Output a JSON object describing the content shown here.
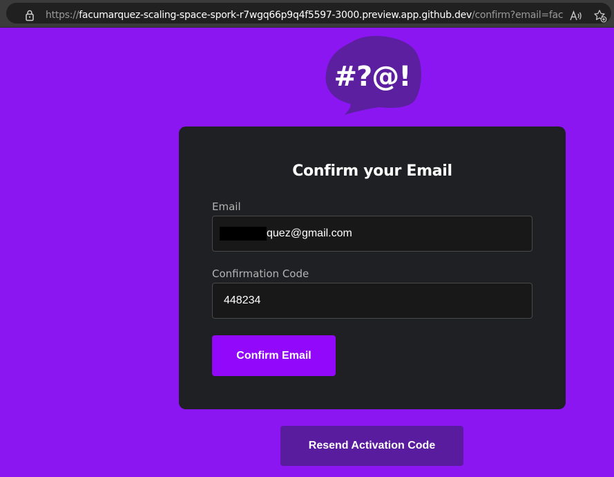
{
  "browser": {
    "url_protocol": "https://",
    "url_host": "facumarquez-scaling-space-spork-r7wgq66p9q4f5597-3000.preview.app.github.dev",
    "url_path": "/confirm?email=facumarque...",
    "read_aloud_icon": "read-aloud-icon",
    "favorite_icon": "favorite-add-icon"
  },
  "logo": {
    "text": "#?@!",
    "color": "#5b1fa0"
  },
  "form": {
    "title": "Confirm your Email",
    "email_label": "Email",
    "email_value_visible": "quez@gmail.com",
    "code_label": "Confirmation Code",
    "code_value": "448234",
    "confirm_label": "Confirm Email"
  },
  "resend": {
    "label": "Resend Activation Code"
  },
  "colors": {
    "background": "#8c16f2",
    "card": "#1f2023",
    "primary_button": "#9208fb",
    "secondary_button": "#5a1c9e"
  }
}
